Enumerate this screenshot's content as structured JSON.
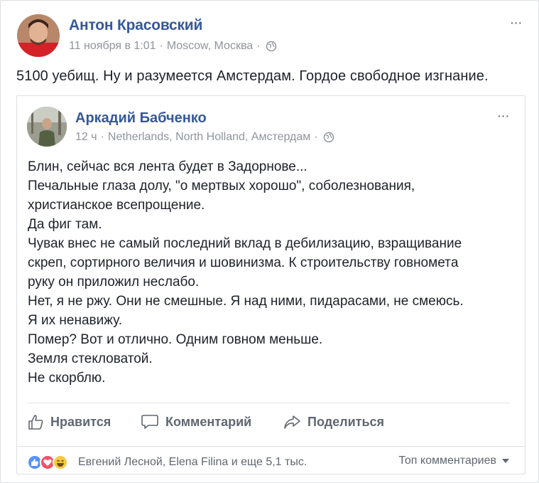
{
  "post": {
    "author": "Антон Красовский",
    "date": "11 ноября в 1:01",
    "sep": "·",
    "location": "Moscow, Москва",
    "more": "···",
    "text": "5100 уебищ. Ну и разумеется Амстердам. Гордое свободное изгнание."
  },
  "shared": {
    "author": "Аркадий Бабченко",
    "time": "12 ч",
    "sep": "·",
    "location": "Netherlands, North Holland, Амстердам",
    "more": "···",
    "lines": [
      "Блин, сейчас вся лента будет в Задорнове...",
      "Печальные глаза долу, \"о мертвых хорошо\", соболезнования,",
      "христианское всепрощение.",
      "Да фиг там.",
      "Чувак внес не самый последний вклад в дебилизацию, взращивание",
      "скреп, сортирного величия и шовинизма. К строительству говнометa",
      "руку он приложил неслабо.",
      "Нет, я не ржу. Они не смешные. Я над ними, пидарасами, не смеюсь.",
      "Я их ненавижу.",
      "Помер? Вот и отлично. Одним говном меньше.",
      "Земля стекловатой.",
      "Не скорблю."
    ],
    "actions": {
      "like": "Нравится",
      "comment": "Комментарий",
      "share": "Поделиться"
    },
    "reactions_text": "Евгений Лесной, Elena Filina и еще 5,1 тыс.",
    "top_comments": "Топ комментариев"
  },
  "colors": {
    "link_blue": "#365899",
    "meta_gray": "#90949c",
    "like_blue": "#5890ff",
    "love_red": "#f25268",
    "haha_yellow": "#f7c93f"
  },
  "icons": [
    "globe-icon",
    "like-thumb-icon",
    "comment-bubble-icon",
    "share-arrow-icon",
    "like-reaction-icon",
    "love-reaction-icon",
    "haha-reaction-icon",
    "caret-down-icon"
  ]
}
